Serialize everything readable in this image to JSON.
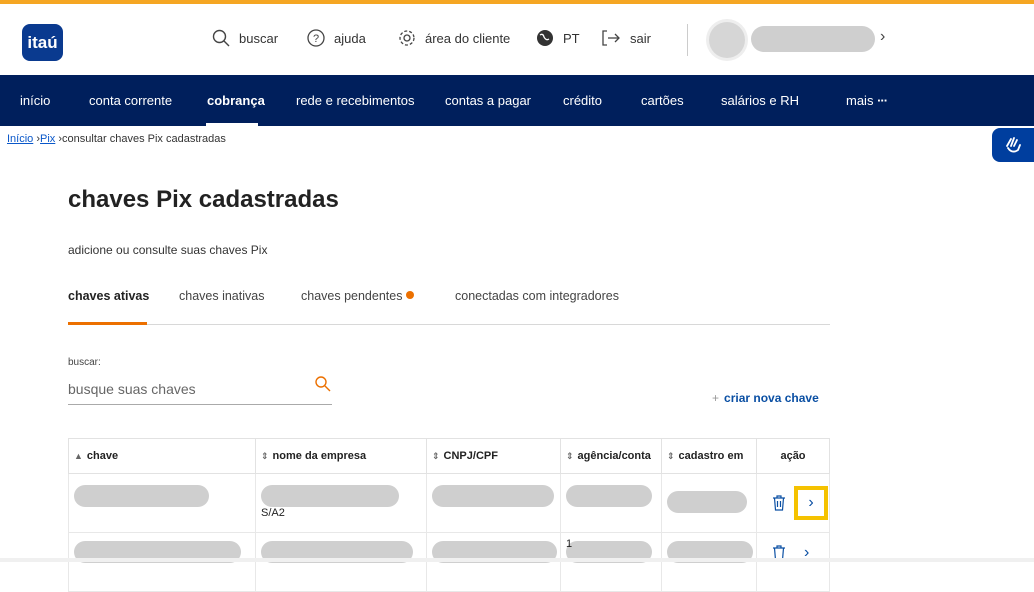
{
  "header": {
    "logo": "itaú",
    "search_label": "buscar",
    "help_label": "ajuda",
    "client_area_label": "área do cliente",
    "language_label": "PT",
    "logout_label": "sair"
  },
  "nav": {
    "items": [
      {
        "label": "início"
      },
      {
        "label": "conta corrente"
      },
      {
        "label": "cobrança"
      },
      {
        "label": "rede e recebimentos"
      },
      {
        "label": "contas a pagar"
      },
      {
        "label": "crédito"
      },
      {
        "label": "cartões"
      },
      {
        "label": "salários e RH"
      },
      {
        "label": "mais"
      }
    ],
    "active": "cobrança"
  },
  "breadcrumb": {
    "home": "Início",
    "pix": "Pix",
    "current": "consultar chaves Pix cadastradas"
  },
  "page": {
    "title": "chaves Pix cadastradas",
    "subtitle": "adicione ou consulte suas chaves Pix"
  },
  "tabs": {
    "items": [
      {
        "label": "chaves ativas"
      },
      {
        "label": "chaves inativas"
      },
      {
        "label": "chaves pendentes"
      },
      {
        "label": "conectadas com integradores"
      }
    ],
    "active": "chaves ativas"
  },
  "search": {
    "label": "buscar:",
    "placeholder": "busque suas chaves"
  },
  "actions": {
    "new_key_plus": "+",
    "new_key_label": "criar nova chave"
  },
  "table": {
    "columns": [
      "chave",
      "nome da empresa",
      "CNPJ/CPF",
      "agência/conta",
      "cadastro em",
      "ação"
    ],
    "rows": [
      {
        "nome_suffix": "S/A2"
      },
      {
        "agencia_prefix": "1"
      }
    ]
  },
  "colors": {
    "brand_blue": "#001f5c",
    "accent_orange": "#ec7000",
    "highlight_yellow": "#f5c200"
  }
}
